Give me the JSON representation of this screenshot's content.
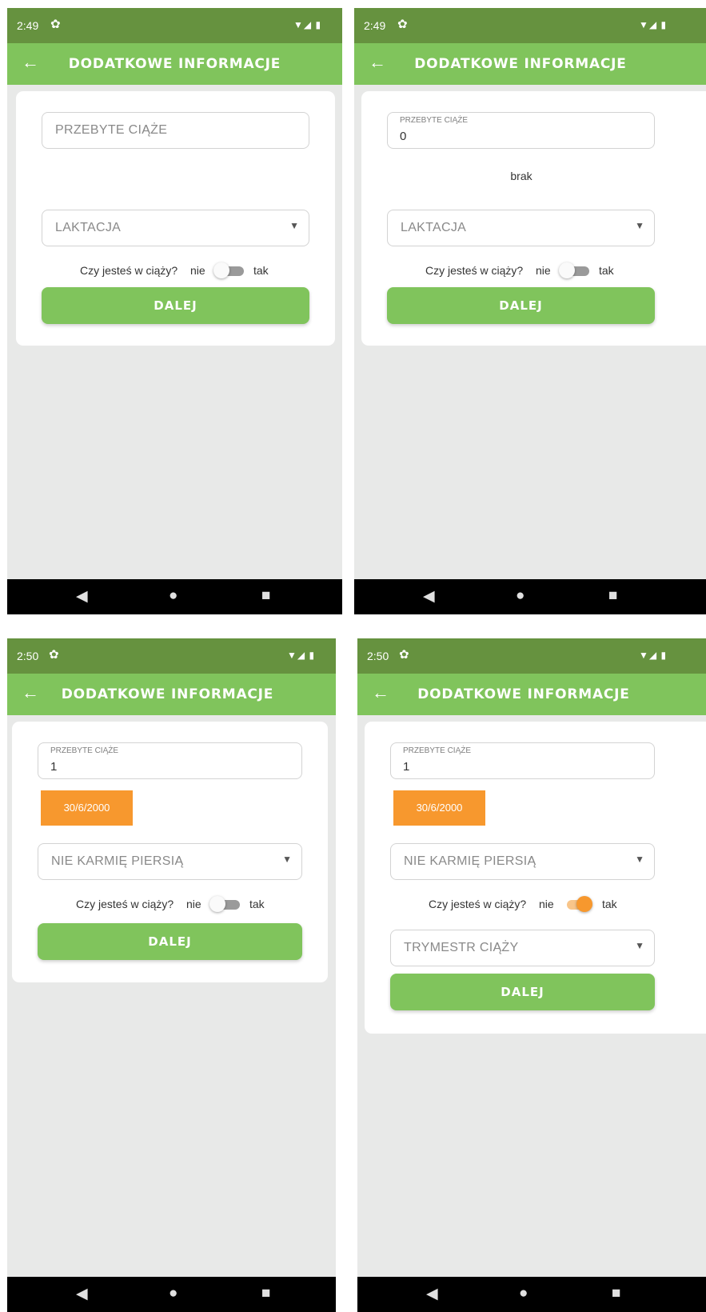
{
  "screens": [
    {
      "time": "2:49",
      "title": "DODATKOWE INFORMACJE",
      "pregnancies_placeholder": "PRZEBYTE CIĄŻE",
      "lactation_placeholder": "LAKTACJA",
      "pregnant_question": "Czy jesteś w ciąży?",
      "no_label": "nie",
      "yes_label": "tak",
      "pregnant_toggle": false,
      "next_button": "DALEJ"
    },
    {
      "time": "2:49",
      "title": "DODATKOWE INFORMACJE",
      "pregnancies_label": "PRZEBYTE CIĄŻE",
      "pregnancies_value": "0",
      "none_text": "brak",
      "lactation_placeholder": "LAKTACJA",
      "pregnant_question": "Czy jesteś w ciąży?",
      "no_label": "nie",
      "yes_label": "tak",
      "pregnant_toggle": false,
      "next_button": "DALEJ"
    },
    {
      "time": "2:50",
      "title": "DODATKOWE INFORMACJE",
      "pregnancies_label": "PRZEBYTE CIĄŻE",
      "pregnancies_value": "1",
      "date_button": "30/6/2000",
      "lactation_value": "NIE KARMIĘ PIERSIĄ",
      "pregnant_question": "Czy jesteś w ciąży?",
      "no_label": "nie",
      "yes_label": "tak",
      "pregnant_toggle": false,
      "next_button": "DALEJ"
    },
    {
      "time": "2:50",
      "title": "DODATKOWE INFORMACJE",
      "pregnancies_label": "PRZEBYTE CIĄŻE",
      "pregnancies_value": "1",
      "date_button": "30/6/2000",
      "lactation_value": "NIE KARMIĘ PIERSIĄ",
      "pregnant_question": "Czy jesteś w ciąży?",
      "no_label": "nie",
      "yes_label": "tak",
      "pregnant_toggle": true,
      "trimester_placeholder": "TRYMESTR CIĄŻY",
      "next_button": "DALEJ"
    }
  ],
  "icons": {
    "settings": "gear-icon",
    "back": "arrow-left-icon",
    "signal": "wifi-signal-battery-icons",
    "dropdown": "caret-down-icon",
    "nav_back": "triangle-back-icon",
    "nav_home": "circle-home-icon",
    "nav_recent": "square-recent-icon"
  },
  "colors": {
    "status_bar": "#66923f",
    "app_bar": "#80c45c",
    "button": "#80c45c",
    "accent_orange": "#f7982e",
    "background": "#e8e9e8"
  }
}
